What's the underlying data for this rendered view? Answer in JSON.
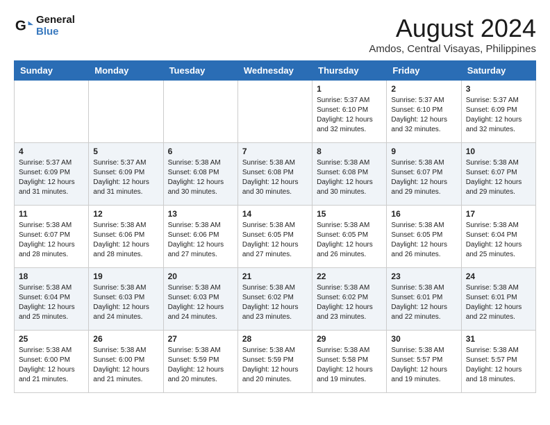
{
  "header": {
    "logo_line1": "General",
    "logo_line2": "Blue",
    "title": "August 2024",
    "subtitle": "Amdos, Central Visayas, Philippines"
  },
  "days_of_week": [
    "Sunday",
    "Monday",
    "Tuesday",
    "Wednesday",
    "Thursday",
    "Friday",
    "Saturday"
  ],
  "weeks": [
    [
      {
        "day": "",
        "info": ""
      },
      {
        "day": "",
        "info": ""
      },
      {
        "day": "",
        "info": ""
      },
      {
        "day": "",
        "info": ""
      },
      {
        "day": "1",
        "info": "Sunrise: 5:37 AM\nSunset: 6:10 PM\nDaylight: 12 hours\nand 32 minutes."
      },
      {
        "day": "2",
        "info": "Sunrise: 5:37 AM\nSunset: 6:10 PM\nDaylight: 12 hours\nand 32 minutes."
      },
      {
        "day": "3",
        "info": "Sunrise: 5:37 AM\nSunset: 6:09 PM\nDaylight: 12 hours\nand 32 minutes."
      }
    ],
    [
      {
        "day": "4",
        "info": "Sunrise: 5:37 AM\nSunset: 6:09 PM\nDaylight: 12 hours\nand 31 minutes."
      },
      {
        "day": "5",
        "info": "Sunrise: 5:37 AM\nSunset: 6:09 PM\nDaylight: 12 hours\nand 31 minutes."
      },
      {
        "day": "6",
        "info": "Sunrise: 5:38 AM\nSunset: 6:08 PM\nDaylight: 12 hours\nand 30 minutes."
      },
      {
        "day": "7",
        "info": "Sunrise: 5:38 AM\nSunset: 6:08 PM\nDaylight: 12 hours\nand 30 minutes."
      },
      {
        "day": "8",
        "info": "Sunrise: 5:38 AM\nSunset: 6:08 PM\nDaylight: 12 hours\nand 30 minutes."
      },
      {
        "day": "9",
        "info": "Sunrise: 5:38 AM\nSunset: 6:07 PM\nDaylight: 12 hours\nand 29 minutes."
      },
      {
        "day": "10",
        "info": "Sunrise: 5:38 AM\nSunset: 6:07 PM\nDaylight: 12 hours\nand 29 minutes."
      }
    ],
    [
      {
        "day": "11",
        "info": "Sunrise: 5:38 AM\nSunset: 6:07 PM\nDaylight: 12 hours\nand 28 minutes."
      },
      {
        "day": "12",
        "info": "Sunrise: 5:38 AM\nSunset: 6:06 PM\nDaylight: 12 hours\nand 28 minutes."
      },
      {
        "day": "13",
        "info": "Sunrise: 5:38 AM\nSunset: 6:06 PM\nDaylight: 12 hours\nand 27 minutes."
      },
      {
        "day": "14",
        "info": "Sunrise: 5:38 AM\nSunset: 6:05 PM\nDaylight: 12 hours\nand 27 minutes."
      },
      {
        "day": "15",
        "info": "Sunrise: 5:38 AM\nSunset: 6:05 PM\nDaylight: 12 hours\nand 26 minutes."
      },
      {
        "day": "16",
        "info": "Sunrise: 5:38 AM\nSunset: 6:05 PM\nDaylight: 12 hours\nand 26 minutes."
      },
      {
        "day": "17",
        "info": "Sunrise: 5:38 AM\nSunset: 6:04 PM\nDaylight: 12 hours\nand 25 minutes."
      }
    ],
    [
      {
        "day": "18",
        "info": "Sunrise: 5:38 AM\nSunset: 6:04 PM\nDaylight: 12 hours\nand 25 minutes."
      },
      {
        "day": "19",
        "info": "Sunrise: 5:38 AM\nSunset: 6:03 PM\nDaylight: 12 hours\nand 24 minutes."
      },
      {
        "day": "20",
        "info": "Sunrise: 5:38 AM\nSunset: 6:03 PM\nDaylight: 12 hours\nand 24 minutes."
      },
      {
        "day": "21",
        "info": "Sunrise: 5:38 AM\nSunset: 6:02 PM\nDaylight: 12 hours\nand 23 minutes."
      },
      {
        "day": "22",
        "info": "Sunrise: 5:38 AM\nSunset: 6:02 PM\nDaylight: 12 hours\nand 23 minutes."
      },
      {
        "day": "23",
        "info": "Sunrise: 5:38 AM\nSunset: 6:01 PM\nDaylight: 12 hours\nand 22 minutes."
      },
      {
        "day": "24",
        "info": "Sunrise: 5:38 AM\nSunset: 6:01 PM\nDaylight: 12 hours\nand 22 minutes."
      }
    ],
    [
      {
        "day": "25",
        "info": "Sunrise: 5:38 AM\nSunset: 6:00 PM\nDaylight: 12 hours\nand 21 minutes."
      },
      {
        "day": "26",
        "info": "Sunrise: 5:38 AM\nSunset: 6:00 PM\nDaylight: 12 hours\nand 21 minutes."
      },
      {
        "day": "27",
        "info": "Sunrise: 5:38 AM\nSunset: 5:59 PM\nDaylight: 12 hours\nand 20 minutes."
      },
      {
        "day": "28",
        "info": "Sunrise: 5:38 AM\nSunset: 5:59 PM\nDaylight: 12 hours\nand 20 minutes."
      },
      {
        "day": "29",
        "info": "Sunrise: 5:38 AM\nSunset: 5:58 PM\nDaylight: 12 hours\nand 19 minutes."
      },
      {
        "day": "30",
        "info": "Sunrise: 5:38 AM\nSunset: 5:57 PM\nDaylight: 12 hours\nand 19 minutes."
      },
      {
        "day": "31",
        "info": "Sunrise: 5:38 AM\nSunset: 5:57 PM\nDaylight: 12 hours\nand 18 minutes."
      }
    ]
  ]
}
